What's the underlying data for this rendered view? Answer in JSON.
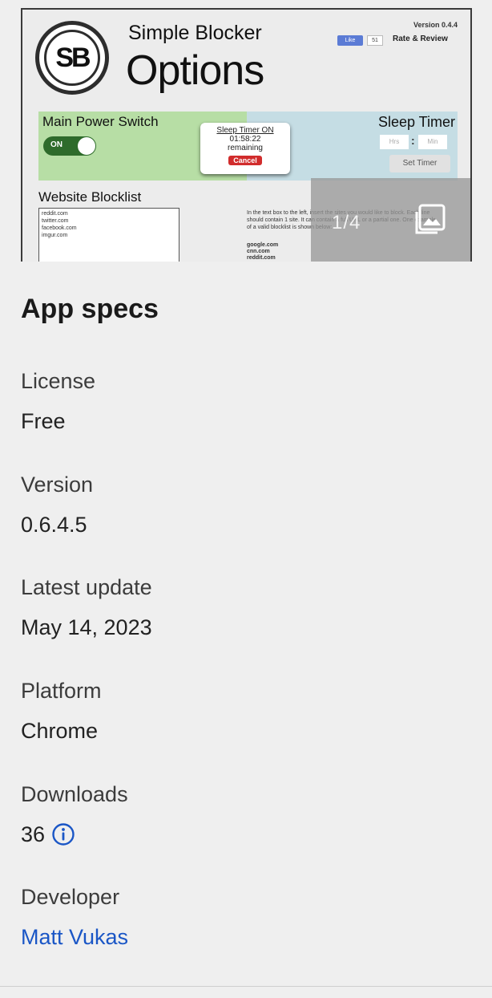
{
  "preview": {
    "logo_text": "SB",
    "title_small": "Simple Blocker",
    "title_big": "Options",
    "version_text": "Version 0.4.4",
    "like_label": "Like",
    "like_count": "51",
    "rate_review": "Rate & Review",
    "main_power_label": "Main Power Switch",
    "toggle_state": "ON",
    "sleep_timer_label": "Sleep Timer",
    "hrs_placeholder": "Hrs",
    "min_placeholder": "Min",
    "set_timer": "Set Timer",
    "popup": {
      "title": "Sleep Timer ON",
      "time": "01:58:22",
      "remaining": "remaining",
      "cancel": "Cancel"
    },
    "blocklist_title": "Website Blocklist",
    "blocklist_entries": "reddit.com\ntwitter.com\nfacebook.com\nimgur.com",
    "instructions": "In the text box to the left, insert the sites you would like to block. Each line should contain 1 site. It can contain a full URL or a partial one. One example of a valid blocklist is shown below:",
    "example_list": "google.com\ncnn.com\nreddit.com",
    "counter": "1/4",
    "colors": {
      "power_panel": "#b7dea5",
      "sleep_panel": "#c5dde4",
      "toggle": "#2e6b2b"
    }
  },
  "specs": {
    "heading": "App specs",
    "license": {
      "label": "License",
      "value": "Free"
    },
    "version": {
      "label": "Version",
      "value": "0.6.4.5"
    },
    "latest_update": {
      "label": "Latest update",
      "value": "May 14, 2023"
    },
    "platform": {
      "label": "Platform",
      "value": "Chrome"
    },
    "downloads": {
      "label": "Downloads",
      "value": "36"
    },
    "developer": {
      "label": "Developer",
      "value": "Matt Vukas"
    }
  },
  "icons": {
    "info": "info-icon",
    "gallery": "gallery-icon"
  },
  "colors": {
    "link": "#1a56c6",
    "background": "#efefef"
  }
}
